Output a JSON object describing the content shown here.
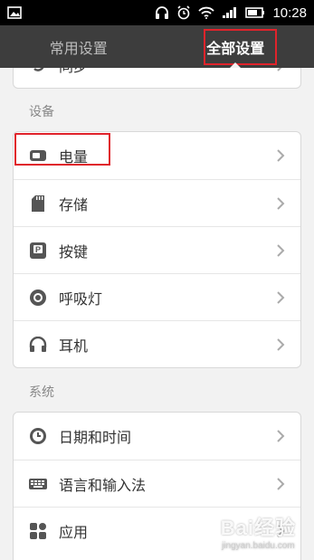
{
  "status_bar": {
    "time": "10:28",
    "icons": [
      "image-icon",
      "headphones-icon",
      "alarm-icon",
      "wifi-icon",
      "signal-icon",
      "battery-icon"
    ]
  },
  "tabs": [
    {
      "label": "常用设置",
      "active": false
    },
    {
      "label": "全部设置",
      "active": true
    }
  ],
  "top_card": {
    "item": {
      "label": "同步",
      "icon": "sync-icon"
    }
  },
  "sections": [
    {
      "title": "设备",
      "items": [
        {
          "label": "电量",
          "icon": "battery-icon"
        },
        {
          "label": "存储",
          "icon": "sd-card-icon"
        },
        {
          "label": "按键",
          "icon": "key-icon"
        },
        {
          "label": "呼吸灯",
          "icon": "light-icon"
        },
        {
          "label": "耳机",
          "icon": "headphones-icon"
        }
      ]
    },
    {
      "title": "系统",
      "items": [
        {
          "label": "日期和时间",
          "icon": "clock-icon"
        },
        {
          "label": "语言和输入法",
          "icon": "keyboard-icon"
        },
        {
          "label": "应用",
          "icon": "apps-icon"
        }
      ]
    }
  ],
  "watermark": {
    "main": "Bai经验",
    "sub": "jingyan.baidu.com"
  },
  "colors": {
    "highlight": "#e0232b",
    "tabbar": "#3d3d3d",
    "background": "#f2f2f2"
  }
}
